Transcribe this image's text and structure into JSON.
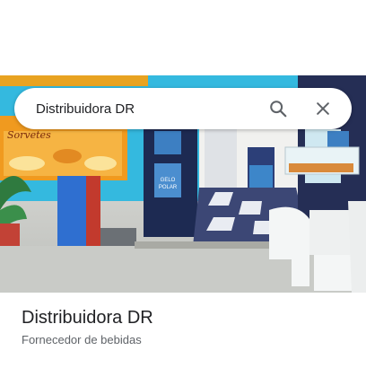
{
  "search": {
    "value": "Distribuidora DR"
  },
  "photo": {
    "sign_text": "Sorvetes",
    "poster_line1": "GELO",
    "poster_line2": "POLAR"
  },
  "place": {
    "title": "Distribuidora DR",
    "category": "Fornecedor de bebidas"
  },
  "icons": {
    "search": "search-icon",
    "close": "close-icon"
  },
  "colors": {
    "text_primary": "#202124",
    "text_secondary": "#5f6368",
    "icon": "#5f6368"
  }
}
